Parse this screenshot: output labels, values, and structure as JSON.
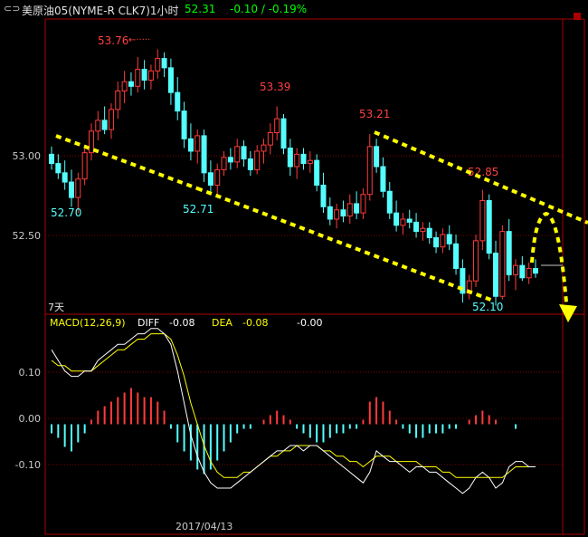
{
  "header": {
    "icon": "link-icon",
    "instrument": "美原油05(NYME-R CLK7)1小时",
    "price": "52.31",
    "change": "-0.10 / -0.19%",
    "price_color": "#00ff00"
  },
  "colors": {
    "up": "#ff3b3b",
    "down": "#54ffff",
    "frame": "#aa0000",
    "axis_label": "#c8c8c8",
    "trendline": "#ffff00",
    "diff_line": "#ffffff",
    "dea_line": "#ffff00"
  },
  "price_panel": {
    "y_ticks": [
      "53.00",
      "52.50"
    ],
    "high_annotations": [
      "53.76",
      "53.39",
      "53.21",
      "52.85"
    ],
    "low_annotations": [
      "52.70",
      "52.71",
      "52.10"
    ],
    "period_label": "7天"
  },
  "macd_panel": {
    "title": "MACD(12,26,9)",
    "diff_label": "DIFF",
    "diff_value": "-0.08",
    "dea_label": "DEA",
    "dea_value": "-0.08",
    "macd_value": "-0.00",
    "y_ticks": [
      "0.10",
      "0.00",
      "-0.10"
    ]
  },
  "x_axis": {
    "date_label": "2017/04/13"
  },
  "chart_data": {
    "type": "candlestick",
    "price_ylim": [
      52.05,
      53.95
    ],
    "candles": [
      [
        53.08,
        53.13,
        52.98,
        53.02
      ],
      [
        53.02,
        53.08,
        52.92,
        52.96
      ],
      [
        52.96,
        53.04,
        52.85,
        52.9
      ],
      [
        52.9,
        52.98,
        52.74,
        52.8
      ],
      [
        52.8,
        52.96,
        52.7,
        52.92
      ],
      [
        52.92,
        53.14,
        52.88,
        53.09
      ],
      [
        53.09,
        53.28,
        53.04,
        53.23
      ],
      [
        53.23,
        53.36,
        53.17,
        53.3
      ],
      [
        53.3,
        53.39,
        53.21,
        53.24
      ],
      [
        53.24,
        53.41,
        53.18,
        53.37
      ],
      [
        53.37,
        53.55,
        53.31,
        53.49
      ],
      [
        53.49,
        53.62,
        53.41,
        53.55
      ],
      [
        53.55,
        53.61,
        53.46,
        53.52
      ],
      [
        53.52,
        53.71,
        53.48,
        53.63
      ],
      [
        53.63,
        53.69,
        53.5,
        53.56
      ],
      [
        53.56,
        53.66,
        53.5,
        53.62
      ],
      [
        53.62,
        53.76,
        53.57,
        53.7
      ],
      [
        53.7,
        53.74,
        53.58,
        53.64
      ],
      [
        53.64,
        53.7,
        53.4,
        53.48
      ],
      [
        53.48,
        53.58,
        53.3,
        53.36
      ],
      [
        53.36,
        53.42,
        53.12,
        53.18
      ],
      [
        53.18,
        53.28,
        53.04,
        53.1
      ],
      [
        53.1,
        53.24,
        53.02,
        53.2
      ],
      [
        53.2,
        53.24,
        52.9,
        52.96
      ],
      [
        52.96,
        53.04,
        52.82,
        52.88
      ],
      [
        52.88,
        53.02,
        52.82,
        52.98
      ],
      [
        52.98,
        53.1,
        52.94,
        53.06
      ],
      [
        53.06,
        53.12,
        52.98,
        53.03
      ],
      [
        53.03,
        53.18,
        52.99,
        53.13
      ],
      [
        53.13,
        53.17,
        53.0,
        53.05
      ],
      [
        53.05,
        53.1,
        52.94,
        52.98
      ],
      [
        52.98,
        53.14,
        52.95,
        53.1
      ],
      [
        53.1,
        53.18,
        53.02,
        53.14
      ],
      [
        53.14,
        53.28,
        53.08,
        53.22
      ],
      [
        53.22,
        53.39,
        53.17,
        53.31
      ],
      [
        53.31,
        53.34,
        53.08,
        53.12
      ],
      [
        53.12,
        53.18,
        52.94,
        53.0
      ],
      [
        53.0,
        53.12,
        52.92,
        53.08
      ],
      [
        53.08,
        53.12,
        52.98,
        53.02
      ],
      [
        53.02,
        53.1,
        52.96,
        53.04
      ],
      [
        53.04,
        53.08,
        52.84,
        52.88
      ],
      [
        52.88,
        52.96,
        52.7,
        52.74
      ],
      [
        52.74,
        52.8,
        52.62,
        52.66
      ],
      [
        52.66,
        52.76,
        52.6,
        52.72
      ],
      [
        52.72,
        52.78,
        52.64,
        52.68
      ],
      [
        52.68,
        52.82,
        52.63,
        52.76
      ],
      [
        52.76,
        52.84,
        52.66,
        52.7
      ],
      [
        52.7,
        52.86,
        52.66,
        52.82
      ],
      [
        52.82,
        53.21,
        52.78,
        53.13
      ],
      [
        53.13,
        53.18,
        52.96,
        53.0
      ],
      [
        53.0,
        53.06,
        52.8,
        52.84
      ],
      [
        52.84,
        52.9,
        52.66,
        52.7
      ],
      [
        52.7,
        52.78,
        52.58,
        52.62
      ],
      [
        52.62,
        52.7,
        52.56,
        52.66
      ],
      [
        52.66,
        52.72,
        52.6,
        52.64
      ],
      [
        52.64,
        52.7,
        52.54,
        52.58
      ],
      [
        52.58,
        52.64,
        52.52,
        52.6
      ],
      [
        52.6,
        52.64,
        52.5,
        52.54
      ],
      [
        52.54,
        52.58,
        52.44,
        52.48
      ],
      [
        52.48,
        52.6,
        52.44,
        52.56
      ],
      [
        52.56,
        52.62,
        52.46,
        52.5
      ],
      [
        52.5,
        52.56,
        52.3,
        52.34
      ],
      [
        52.34,
        52.4,
        52.12,
        52.18
      ],
      [
        52.18,
        52.3,
        52.14,
        52.26
      ],
      [
        52.26,
        52.56,
        52.22,
        52.52
      ],
      [
        52.52,
        52.85,
        52.46,
        52.78
      ],
      [
        52.78,
        52.82,
        52.4,
        52.44
      ],
      [
        52.44,
        52.52,
        52.1,
        52.16
      ],
      [
        52.16,
        52.62,
        52.14,
        52.58
      ],
      [
        52.58,
        52.66,
        52.26,
        52.3
      ],
      [
        52.3,
        52.4,
        52.2,
        52.36
      ],
      [
        52.36,
        52.42,
        52.26,
        52.28
      ],
      [
        52.28,
        52.38,
        52.24,
        52.34
      ],
      [
        52.34,
        52.4,
        52.28,
        52.31
      ]
    ],
    "macd_ylim": [
      -0.205,
      0.205
    ],
    "macd_hist": [
      -0.02,
      -0.03,
      -0.05,
      -0.06,
      -0.04,
      -0.02,
      0.01,
      0.03,
      0.04,
      0.05,
      0.06,
      0.07,
      0.08,
      0.07,
      0.06,
      0.06,
      0.05,
      0.03,
      -0.01,
      -0.04,
      -0.06,
      -0.08,
      -0.1,
      -0.11,
      -0.1,
      -0.08,
      -0.06,
      -0.04,
      -0.02,
      -0.01,
      -0.01,
      0.0,
      0.01,
      0.02,
      0.03,
      0.02,
      0.01,
      -0.01,
      -0.02,
      -0.03,
      -0.04,
      -0.04,
      -0.03,
      -0.02,
      -0.02,
      -0.01,
      -0.01,
      0.01,
      0.05,
      0.06,
      0.05,
      0.03,
      0.01,
      -0.01,
      -0.02,
      -0.03,
      -0.03,
      -0.02,
      -0.02,
      -0.02,
      -0.01,
      -0.01,
      0.0,
      0.01,
      0.02,
      0.03,
      0.02,
      0.01,
      0.0,
      0.0,
      -0.01,
      0.0,
      0.0,
      0.0
    ],
    "diff": [
      0.14,
      0.12,
      0.1,
      0.09,
      0.09,
      0.1,
      0.1,
      0.12,
      0.13,
      0.14,
      0.15,
      0.15,
      0.16,
      0.17,
      0.17,
      0.18,
      0.18,
      0.17,
      0.15,
      0.1,
      0.04,
      -0.02,
      -0.06,
      -0.09,
      -0.11,
      -0.12,
      -0.12,
      -0.12,
      -0.11,
      -0.1,
      -0.09,
      -0.08,
      -0.07,
      -0.06,
      -0.05,
      -0.05,
      -0.04,
      -0.04,
      -0.05,
      -0.04,
      -0.04,
      -0.05,
      -0.06,
      -0.07,
      -0.08,
      -0.09,
      -0.1,
      -0.11,
      -0.09,
      -0.05,
      -0.06,
      -0.07,
      -0.07,
      -0.08,
      -0.09,
      -0.08,
      -0.08,
      -0.09,
      -0.09,
      -0.1,
      -0.11,
      -0.12,
      -0.13,
      -0.12,
      -0.1,
      -0.09,
      -0.1,
      -0.12,
      -0.11,
      -0.08,
      -0.07,
      -0.07,
      -0.08,
      -0.08
    ],
    "dea": [
      0.12,
      0.11,
      0.11,
      0.1,
      0.1,
      0.1,
      0.1,
      0.11,
      0.12,
      0.13,
      0.14,
      0.14,
      0.15,
      0.16,
      0.16,
      0.17,
      0.17,
      0.17,
      0.16,
      0.13,
      0.09,
      0.04,
      0.0,
      -0.04,
      -0.07,
      -0.09,
      -0.1,
      -0.1,
      -0.1,
      -0.09,
      -0.09,
      -0.08,
      -0.07,
      -0.06,
      -0.06,
      -0.05,
      -0.05,
      -0.04,
      -0.04,
      -0.04,
      -0.04,
      -0.05,
      -0.05,
      -0.06,
      -0.06,
      -0.07,
      -0.07,
      -0.08,
      -0.07,
      -0.06,
      -0.06,
      -0.06,
      -0.07,
      -0.07,
      -0.07,
      -0.07,
      -0.08,
      -0.08,
      -0.08,
      -0.09,
      -0.09,
      -0.1,
      -0.1,
      -0.1,
      -0.1,
      -0.1,
      -0.1,
      -0.1,
      -0.1,
      -0.09,
      -0.08,
      -0.08,
      -0.08,
      -0.08
    ]
  }
}
